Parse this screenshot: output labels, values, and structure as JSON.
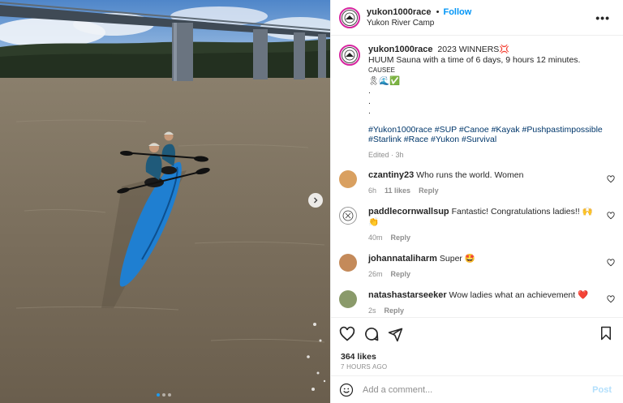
{
  "post": {
    "username": "yukon1000race",
    "separator": "•",
    "follow_label": "Follow",
    "location": "Yukon River Camp",
    "more_icon": "more-horizontal-icon"
  },
  "caption": {
    "username": "yukon1000race",
    "line1": "2023 WINNERS💢",
    "line2_main": "HUUM Sauna with a time of 6 days, 9 hours 12 minutes.",
    "line2_small": "CAUSEE",
    "emoji_line": "🎗🌊✅",
    "dot1": ".",
    "dot2": ".",
    "dot3": ".",
    "hashtags_line1": "#Yukon1000race #SUP #Canoe #Kayak #Pushpastimpossible",
    "hashtags_line2": "#Starlink #Race #Yukon #Survival",
    "edited": "Edited · 3h"
  },
  "comments": [
    {
      "username": "czantiny23",
      "text": "Who runs the world. Women",
      "time": "6h",
      "likes": "11 likes",
      "reply": "Reply",
      "avatar_color": "#d9a060"
    },
    {
      "username": "paddlecornwallsup",
      "text": "Fantastic! Congratulations ladies!! 🙌👏",
      "time": "40m",
      "likes": "",
      "reply": "Reply",
      "avatar_color": "#ffffff"
    },
    {
      "username": "johannataliharm",
      "text": "Super 🤩",
      "time": "26m",
      "likes": "",
      "reply": "Reply",
      "avatar_color": "#c48a5a"
    },
    {
      "username": "natashastarseeker",
      "text": "Wow ladies what an achievement ❤️",
      "time": "2s",
      "likes": "",
      "reply": "Reply",
      "avatar_color": "#8a9a6a"
    }
  ],
  "engagement": {
    "likes": "364 likes",
    "time_ago": "7 HOURS AGO"
  },
  "comment_box": {
    "placeholder": "Add a comment...",
    "post_label": "Post"
  },
  "carousel": {
    "total": 3,
    "active": 1
  }
}
